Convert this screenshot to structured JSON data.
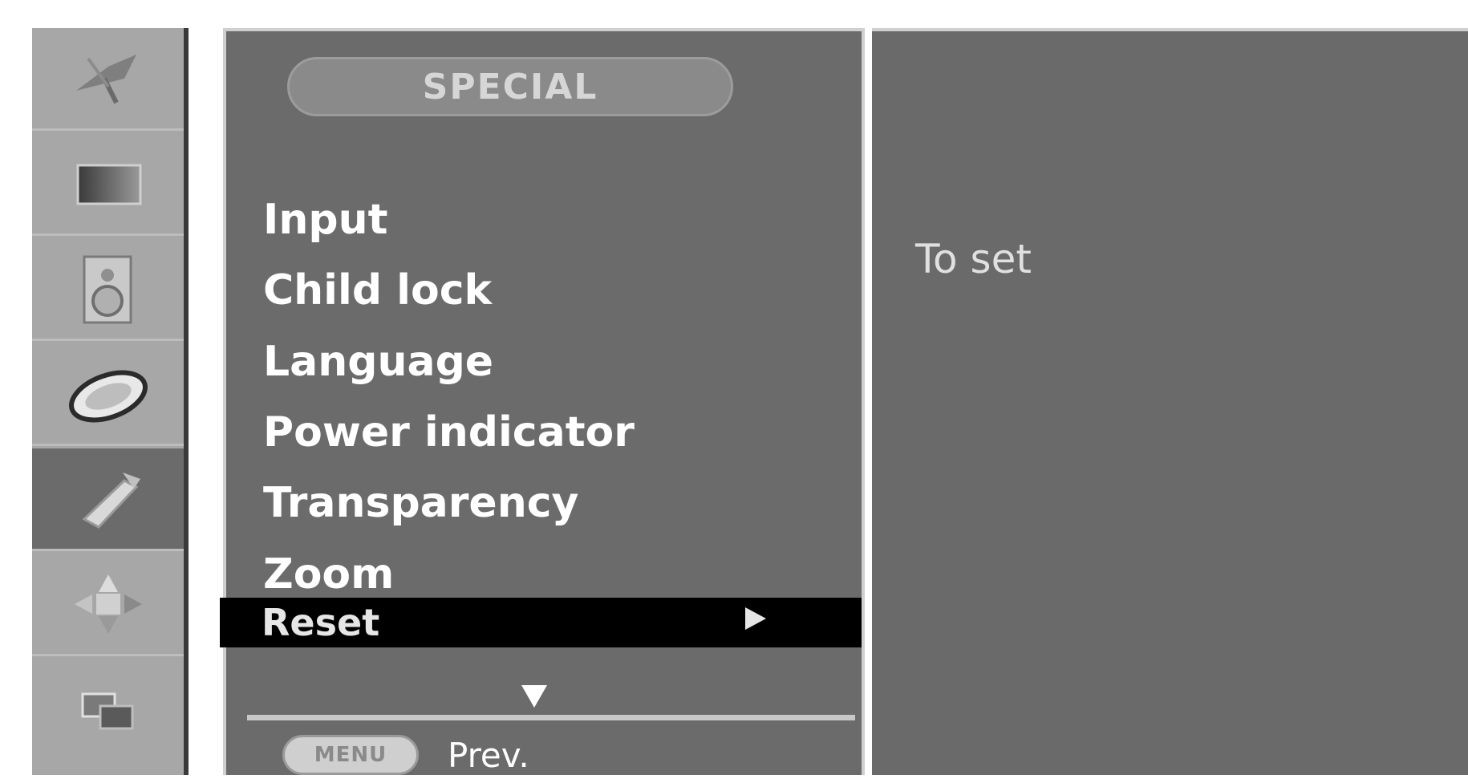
{
  "sidebar": {
    "items": [
      {
        "icon": "satellite-dish-icon"
      },
      {
        "icon": "picture-icon"
      },
      {
        "icon": "speaker-icon"
      },
      {
        "icon": "disc-icon"
      },
      {
        "icon": "tool-icon",
        "active": true
      },
      {
        "icon": "direction-pad-icon"
      },
      {
        "icon": "screen-layers-icon"
      }
    ]
  },
  "menu": {
    "title": "SPECIAL",
    "items": [
      "Input",
      "Child lock",
      "Language",
      "Power indicator",
      "Transparency",
      "Zoom"
    ],
    "selected": "Reset",
    "footer_button": "MENU",
    "footer_label": "Prev."
  },
  "description": {
    "text": "To set"
  }
}
